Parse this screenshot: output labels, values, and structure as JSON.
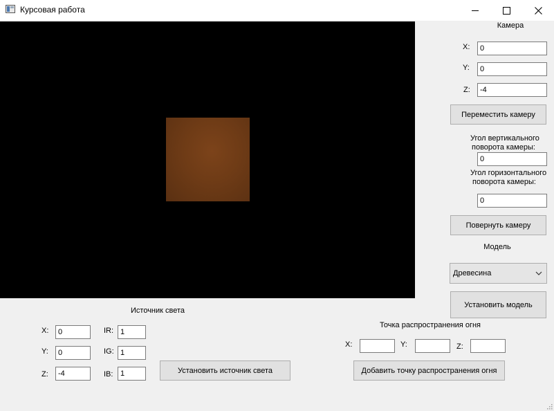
{
  "window": {
    "title": "Курсовая работа"
  },
  "camera": {
    "heading": "Камера",
    "x_label": "X:",
    "x_value": "0",
    "y_label": "Y:",
    "y_value": "0",
    "z_label": "Z:",
    "z_value": "-4",
    "move_button": "Переместить камеру",
    "vertical_angle_label_1": "Угол вертикального",
    "vertical_angle_label_2": "поворота камеры:",
    "vertical_angle_value": "0",
    "horizontal_angle_label_1": "Угол горизонтального",
    "horizontal_angle_label_2": "поворота камеры:",
    "horizontal_angle_value": "0",
    "rotate_button": "Повернуть камеру"
  },
  "model": {
    "heading": "Модель",
    "selected": "Древесина",
    "set_button": "Установить модель"
  },
  "light": {
    "heading": "Источник света",
    "x_label": "X:",
    "x_value": "0",
    "y_label": "Y:",
    "y_value": "0",
    "z_label": "Z:",
    "z_value": "-4",
    "ir_label": "IR:",
    "ir_value": "1",
    "ig_label": "IG:",
    "ig_value": "1",
    "ib_label": "IB:",
    "ib_value": "1",
    "set_button": "Установить источник света"
  },
  "fire": {
    "heading": "Точка распространения огня",
    "x_label": "X:",
    "x_value": "",
    "y_label": "Y:",
    "y_value": "",
    "z_label": "Z:",
    "z_value": "",
    "add_button": "Добавить точку распространения огня"
  },
  "colors": {
    "viewport_bg": "#000000",
    "wood": "#6e3b16",
    "window_bg": "#f0f0f0"
  }
}
